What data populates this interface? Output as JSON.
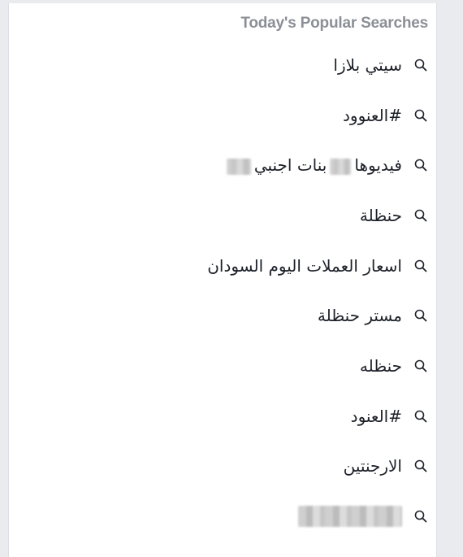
{
  "header": {
    "title": "Today's Popular Searches"
  },
  "searches": [
    {
      "label": "سيتي بلازا",
      "icon": "search-icon"
    },
    {
      "label": "#العنوود",
      "icon": "search-icon"
    },
    {
      "label_part1": "بنات اجنبي",
      "label_part2": "فيديوها",
      "icon": "search-icon"
    },
    {
      "label": "حنظلة",
      "icon": "search-icon"
    },
    {
      "label": "اسعار العملات اليوم السودان",
      "icon": "search-icon"
    },
    {
      "label": "مستر حنظلة",
      "icon": "search-icon"
    },
    {
      "label": "حنظله",
      "icon": "search-icon"
    },
    {
      "label": "#العنود",
      "icon": "search-icon"
    },
    {
      "label": "الارجنتين",
      "icon": "search-icon"
    },
    {
      "label": "",
      "icon": "search-icon"
    }
  ],
  "colors": {
    "header_text": "#8b8f96",
    "item_text": "#1d2129",
    "background": "#e9ebee",
    "panel": "#ffffff"
  }
}
